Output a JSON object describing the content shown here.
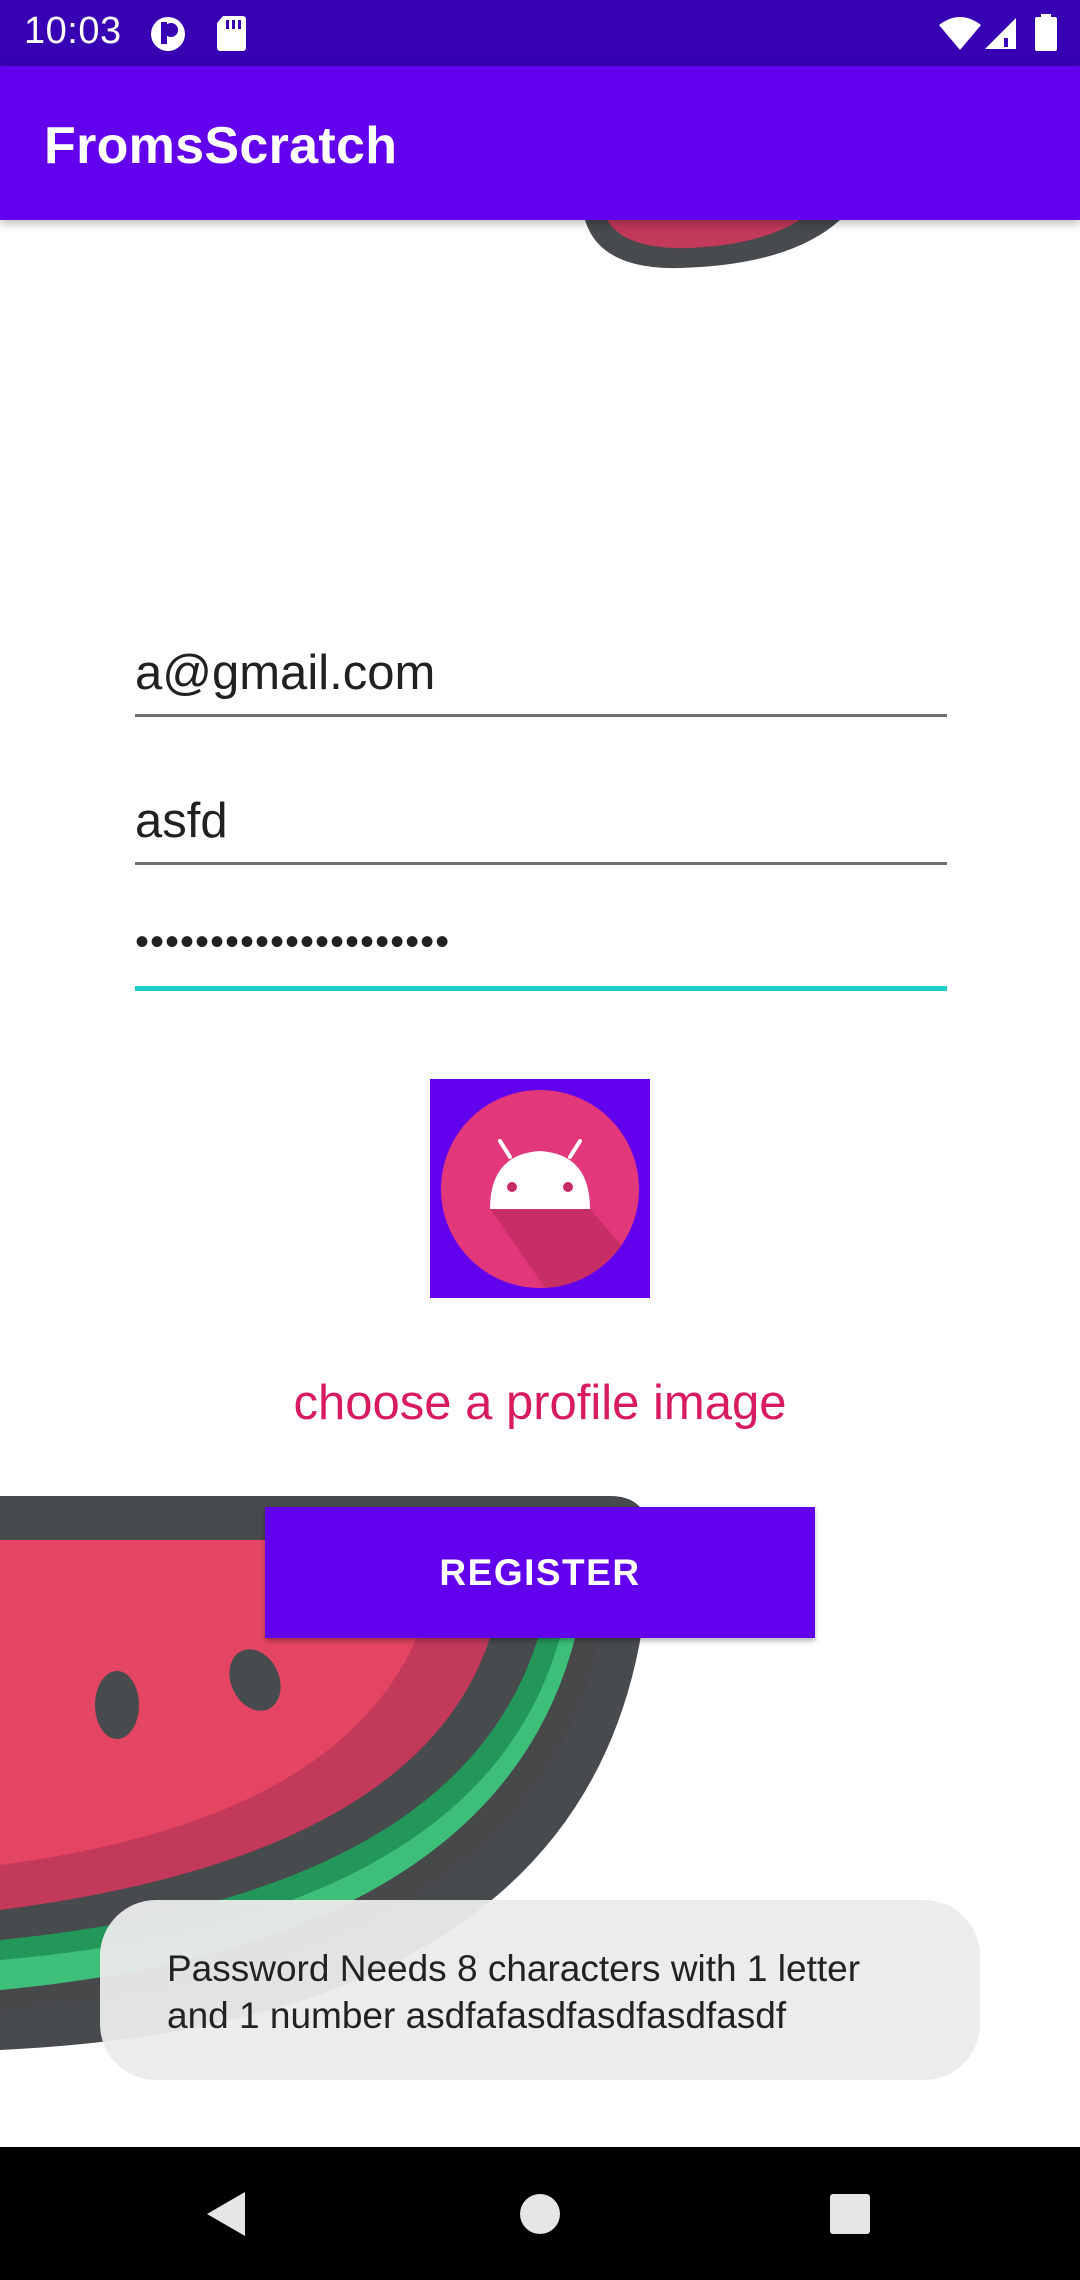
{
  "status_bar": {
    "time": "10:03",
    "left_icons": [
      "sync-icon",
      "sd-card-icon"
    ],
    "right_icons": [
      "wifi-icon",
      "cellular-signal-icon",
      "battery-icon"
    ],
    "background": "#3700B3"
  },
  "app_bar": {
    "title": "FromsScratch",
    "background": "#6200EE"
  },
  "form": {
    "email_value": "a@gmail.com",
    "username_value": "asfd",
    "password_value": "•••••••••••••••••••••",
    "accent_color": "#1FCECB"
  },
  "profile": {
    "image_icon": "android-icon",
    "choose_label": "choose a profile image",
    "label_color": "#D81B60"
  },
  "register": {
    "label": "REGISTER",
    "background": "#6200EE"
  },
  "toast": {
    "message": "Password Needs 8 characters with 1 letter and 1 number asdfafasdfasdfasdfasdf"
  },
  "nav_bar": {
    "buttons": [
      "back-icon",
      "home-icon",
      "recents-icon"
    ]
  }
}
